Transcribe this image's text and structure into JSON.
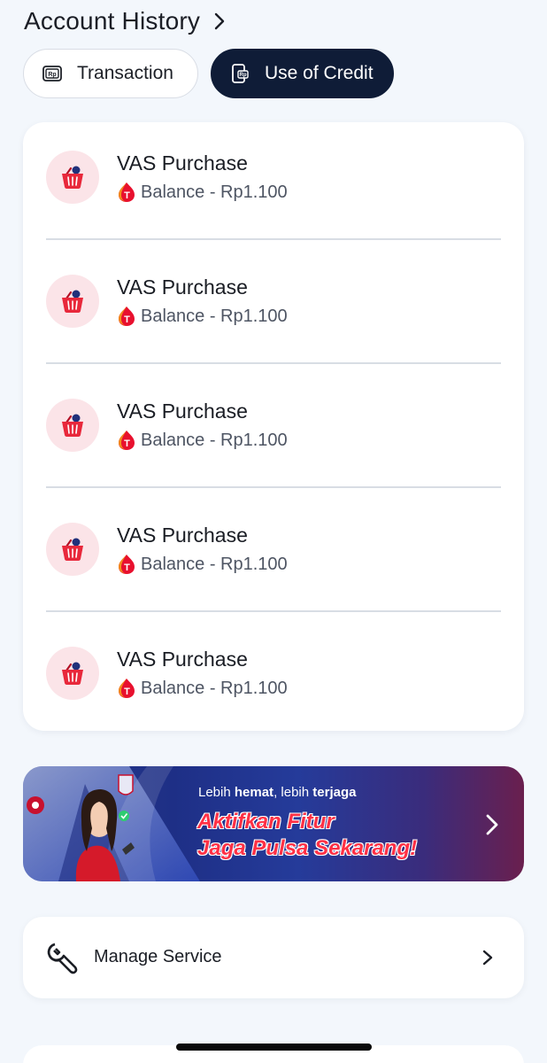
{
  "header": {
    "title": "Account History"
  },
  "tabs": [
    {
      "label": "Transaction",
      "icon": "rp-receipt-icon",
      "active": false
    },
    {
      "label": "Use of Credit",
      "icon": "rp-phone-icon",
      "active": true
    }
  ],
  "history": {
    "items": [
      {
        "title": "VAS Purchase",
        "detail": "Balance - Rp1.100",
        "icon": "shopping-basket-icon"
      },
      {
        "title": "VAS Purchase",
        "detail": "Balance - Rp1.100",
        "icon": "shopping-basket-icon"
      },
      {
        "title": "VAS Purchase",
        "detail": "Balance - Rp1.100",
        "icon": "shopping-basket-icon"
      },
      {
        "title": "VAS Purchase",
        "detail": "Balance - Rp1.100",
        "icon": "shopping-basket-icon"
      },
      {
        "title": "VAS Purchase",
        "detail": "Balance - Rp1.100",
        "icon": "shopping-basket-icon"
      }
    ]
  },
  "banner": {
    "small_prefix": "Lebih ",
    "small_bold_1": "hemat",
    "small_mid": ", lebih ",
    "small_bold_2": "terjaga",
    "headline_line1": "Aktifkan Fitur",
    "headline_line2": "Jaga Pulsa Sekarang!"
  },
  "manage_service": {
    "label": "Manage Service"
  },
  "colors": {
    "background": "#f3f7fc",
    "active_tab": "#0f1c37",
    "icon_circle": "#fbe4e8",
    "brand_red": "#e8102e",
    "headline_red": "#ff3045"
  }
}
